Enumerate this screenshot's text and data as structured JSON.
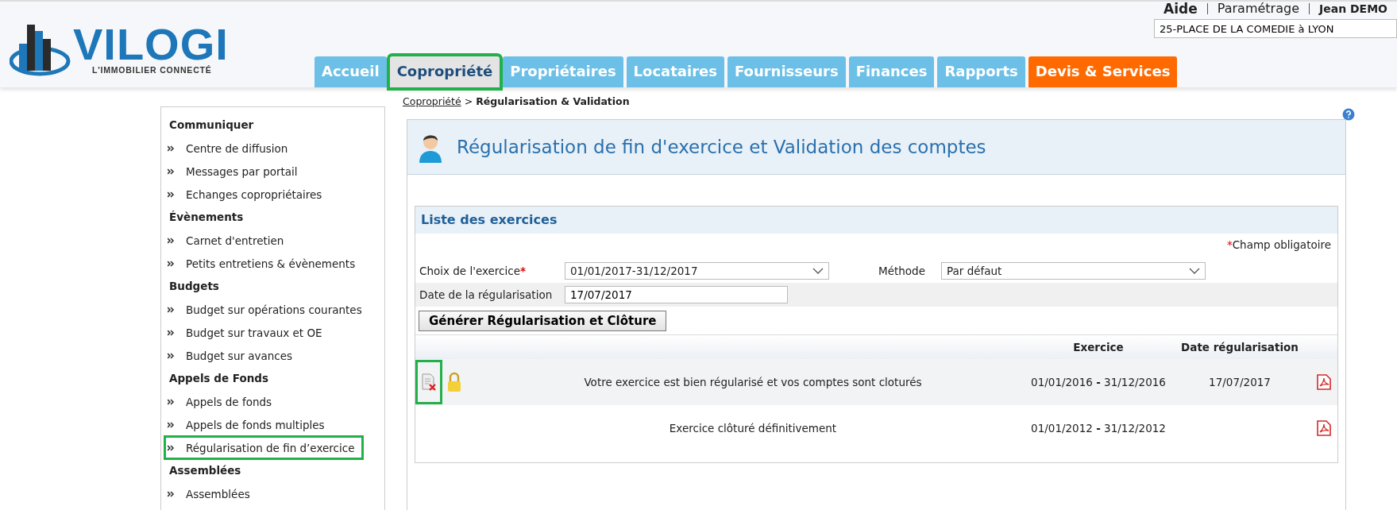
{
  "header": {
    "logo_name": "VILOGI",
    "logo_tagline": "L'IMMOBILIER CONNECTÉ",
    "top_links": [
      {
        "label": "Aide",
        "kind": "strong"
      },
      {
        "label": "Paramétrage",
        "kind": "plain"
      },
      {
        "label": "Jean DEMO",
        "kind": "user"
      }
    ],
    "address": {
      "value": "25-PLACE DE LA COMEDIE à LYON"
    },
    "tabs": [
      {
        "label": "Accueil",
        "selected": false,
        "kind": "normal"
      },
      {
        "label": "Copropriété",
        "selected": true,
        "kind": "normal"
      },
      {
        "label": "Propriétaires",
        "selected": false,
        "kind": "normal"
      },
      {
        "label": "Locataires",
        "selected": false,
        "kind": "normal"
      },
      {
        "label": "Fournisseurs",
        "selected": false,
        "kind": "normal"
      },
      {
        "label": "Finances",
        "selected": false,
        "kind": "normal"
      },
      {
        "label": "Rapports",
        "selected": false,
        "kind": "normal"
      },
      {
        "label": "Devis & Services",
        "selected": false,
        "kind": "promo"
      }
    ]
  },
  "sidebar": {
    "sections": [
      {
        "title": "Communiquer",
        "items": [
          {
            "label": "Centre de diffusion",
            "selected": false
          },
          {
            "label": "Messages par portail",
            "selected": false
          },
          {
            "label": "Echanges copropriétaires",
            "selected": false
          }
        ]
      },
      {
        "title": "Évènements",
        "items": [
          {
            "label": "Carnet d'entretien",
            "selected": false
          },
          {
            "label": "Petits entretiens & évènements",
            "selected": false
          }
        ]
      },
      {
        "title": "Budgets",
        "items": [
          {
            "label": "Budget sur opérations courantes",
            "selected": false
          },
          {
            "label": "Budget sur travaux et OE",
            "selected": false
          },
          {
            "label": "Budget sur avances",
            "selected": false
          }
        ]
      },
      {
        "title": "Appels de Fonds",
        "items": [
          {
            "label": "Appels de fonds",
            "selected": false
          },
          {
            "label": "Appels de fonds multiples",
            "selected": false
          },
          {
            "label": "Régularisation de fin d’exercice",
            "selected": true
          }
        ]
      },
      {
        "title": "Assemblées",
        "items": [
          {
            "label": "Assemblées",
            "selected": false
          }
        ]
      }
    ]
  },
  "breadcrumb": {
    "link": "Copropriété",
    "separator": ">",
    "current": "Régularisation & Validation"
  },
  "page_title": "Régularisation de fin d'exercice et Validation des comptes",
  "panel": {
    "title": "Liste des exercices",
    "required_mark": "*",
    "required_note": "Champ obligatoire",
    "form_rows": [
      [
        {
          "label": "Choix de l'exercice",
          "required": true,
          "kind": "select",
          "value": "01/01/2017-31/12/2017"
        },
        {
          "label": "Méthode",
          "required": false,
          "kind": "select",
          "value": "Par défaut"
        }
      ],
      [
        {
          "label": "Date de la régularisation",
          "required": false,
          "kind": "text",
          "value": "17/07/2017"
        }
      ]
    ],
    "button": "Générer Régularisation et Clôture",
    "columns": [
      "Exercice",
      "Date régularisation"
    ],
    "rows": [
      {
        "message": "Votre exercice est bien régularisé et vos comptes sont cloturés",
        "period": "01/01/2016 **-** 31/12/2016",
        "date": "17/07/2017",
        "deletable": true,
        "locked": true,
        "highlighted": true
      },
      {
        "message": "Exercice clôturé définitivement",
        "period": "01/01/2012 **-** 31/12/2012",
        "deletable": false,
        "locked": false,
        "highlighted": false
      }
    ]
  }
}
